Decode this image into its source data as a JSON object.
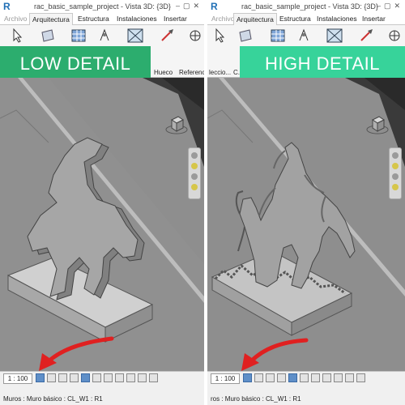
{
  "left": {
    "title": "rac_basic_sample_project - Vista 3D: {3D}",
    "tabs": [
      "Archivo",
      "Arquitectura",
      "Estructura",
      "Instalaciones",
      "Insertar"
    ],
    "ribbon_labels": [
      "Hueco",
      "Referencia"
    ],
    "banner": "LOW DETAIL",
    "scale": "1 : 100",
    "status": "Muros : Muro básico : CL_W1 : R1"
  },
  "right": {
    "title": "rac_basic_sample_project - Vista 3D: {3D}",
    "tabs": [
      "Archivo",
      "Arquitectura",
      "Estructura",
      "Instalaciones",
      "Insertar"
    ],
    "ribbon_labels": [
      "leccio...",
      "C..."
    ],
    "banner": "HIGH DETAIL",
    "scale": "1 : 100",
    "status": "ros : Muro básico : CL_W1 : R1"
  },
  "app_icon": "R",
  "colors": {
    "banner_left": "#2cad6e",
    "banner_right": "#37d39a",
    "annotation_arrow": "#e02020",
    "viewport_floor": "#8d8d8d"
  },
  "icons": [
    "revit-logo-icon",
    "select-icon",
    "wall-icon",
    "grid-icon",
    "door-icon",
    "opening-icon",
    "reference-plane-icon",
    "viewcube-icon",
    "navigation-bar-icon",
    "red-arrow-icon"
  ]
}
